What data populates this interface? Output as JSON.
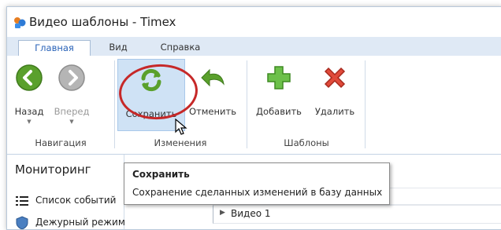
{
  "window": {
    "title": "Видео шаблоны - Timex"
  },
  "tabs": [
    {
      "label": "Главная",
      "active": true
    },
    {
      "label": "Вид",
      "active": false
    },
    {
      "label": "Справка",
      "active": false
    }
  ],
  "ribbon": {
    "groups": [
      {
        "label": "Навигация"
      },
      {
        "label": "Изменения"
      },
      {
        "label": "Шаблоны"
      }
    ],
    "buttons": {
      "back": "Назад",
      "forward": "Вперед",
      "save": "Сохранить",
      "cancel": "Отменить",
      "add": "Добавить",
      "delete": "Удалить"
    }
  },
  "left_panel": {
    "title": "Мониторинг",
    "items": [
      {
        "label": "Список событий",
        "icon": "list-icon"
      },
      {
        "label": "Дежурный режим",
        "icon": "shield-icon"
      }
    ]
  },
  "main": {
    "rows": [
      {
        "label": "Видео 1"
      }
    ]
  },
  "tooltip": {
    "title": "Сохранить",
    "text": "Сохранение сделанных изменений в базу данных"
  },
  "colors": {
    "accent_tab": "#2a63b8",
    "annotation_circle": "#c62828",
    "hover_highlight": "#cfe2f5"
  }
}
